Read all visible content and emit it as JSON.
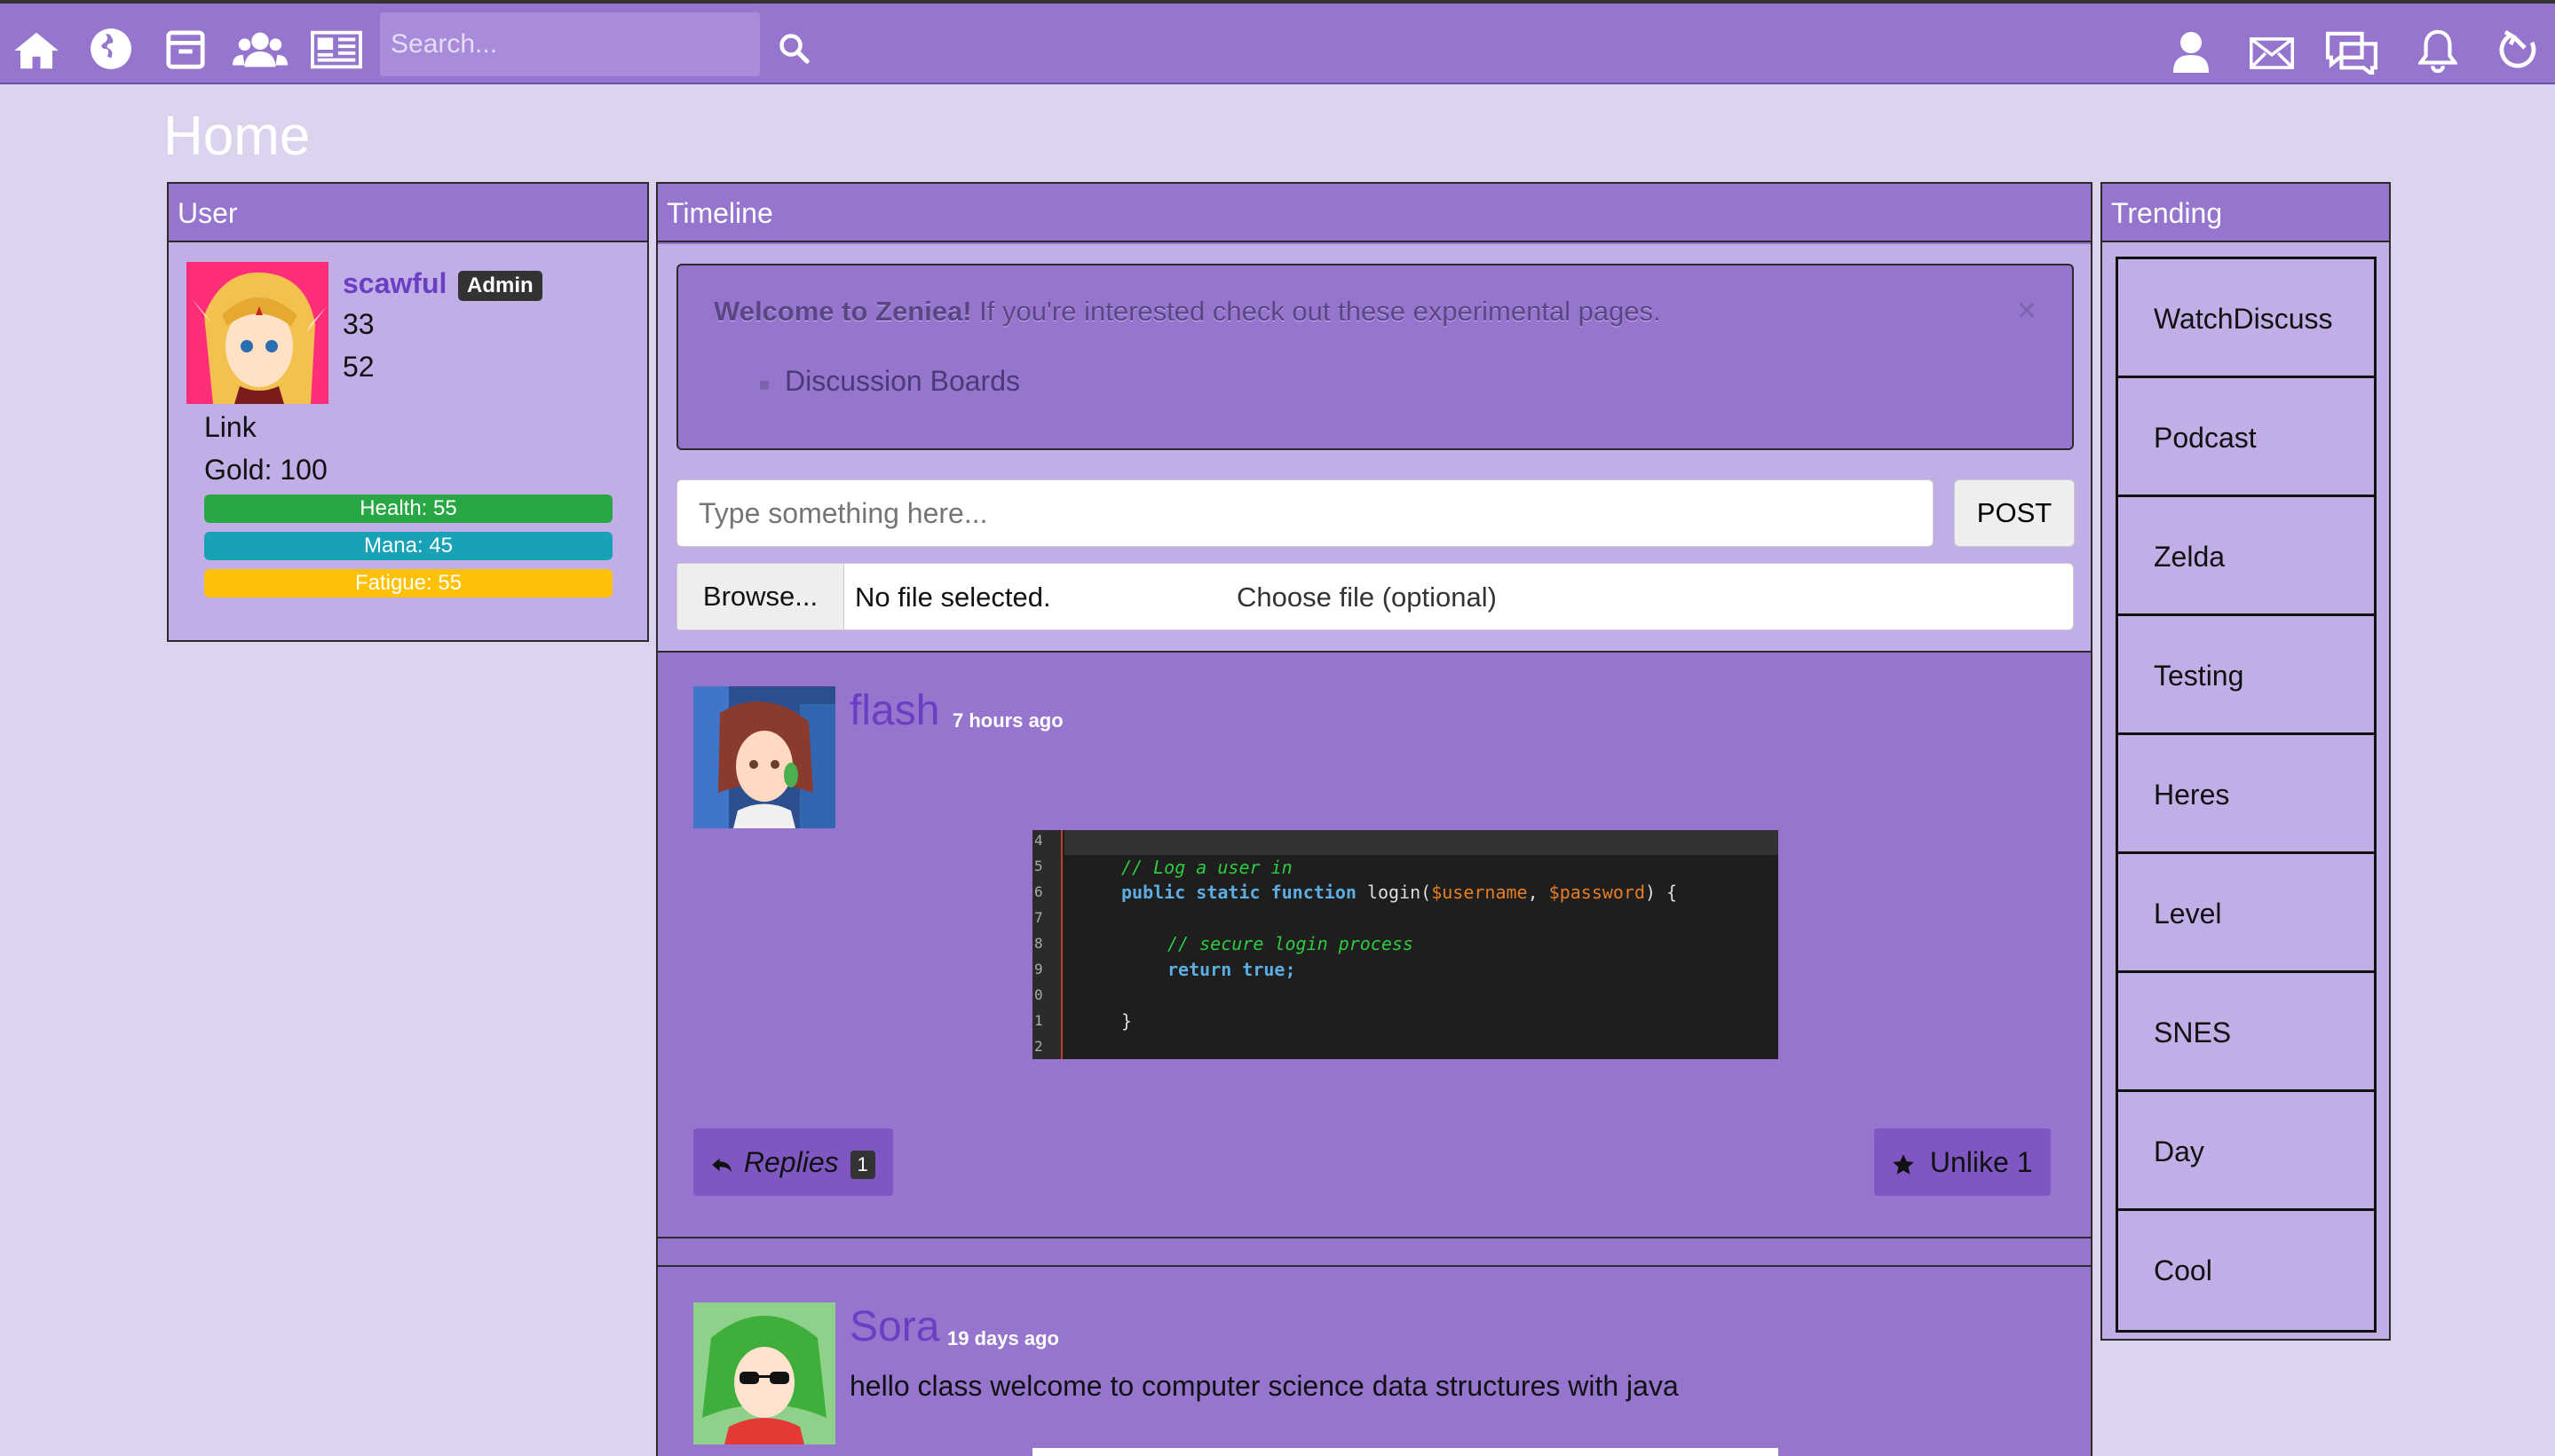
{
  "nav": {
    "icons": [
      "home-icon",
      "globe-icon",
      "inbox-icon",
      "users-icon",
      "newspaper-icon",
      "search-icon",
      "user-icon",
      "mail-icon",
      "chat-icon",
      "bell-icon",
      "logout-icon"
    ],
    "search_placeholder": "Search..."
  },
  "page": {
    "title": "Home"
  },
  "user_panel": {
    "heading": "User",
    "username": "scawful",
    "badge": "Admin",
    "stat1": "33",
    "stat2": "52",
    "character": "Link",
    "gold": "Gold: 100",
    "health_label": "Health: 55",
    "mana_label": "Mana: 45",
    "fatigue_label": "Fatigue: 55",
    "health_value": 55,
    "mana_value": 45,
    "fatigue_value": 55,
    "colors": {
      "health": "#28a745",
      "mana": "#17a2b8",
      "fatigue": "#ffc107"
    }
  },
  "timeline": {
    "heading": "Timeline",
    "alert": {
      "bold": "Welcome to Zeniea!",
      "text": " If you're interested check out these experimental pages.",
      "close": "×",
      "link": "Discussion Boards"
    },
    "post_placeholder": "Type something here...",
    "post_button": "POST",
    "browse_button": "Browse...",
    "file_status": "No file selected.",
    "file_label": "Choose file (optional)",
    "posts": [
      {
        "user": "flash",
        "time": "7 hours ago",
        "code": {
          "line_numbers": [
            "4",
            "5",
            "6",
            "7",
            "8",
            "9",
            "0",
            "1",
            "2"
          ],
          "comment1": "// Log a user in",
          "kw": "public static function",
          "fn": " login(",
          "arg1": "$username",
          "sep": ", ",
          "arg2": "$password",
          "close": ") {",
          "comment2": "// secure login process",
          "ret": "return true;",
          "brace": "}"
        },
        "replies_label": "Replies",
        "replies_count": "1",
        "like_label": "Unlike 1"
      },
      {
        "user": "Sora",
        "time": "19 days ago",
        "text": "hello class welcome to computer science data structures with java"
      }
    ]
  },
  "trending": {
    "heading": "Trending",
    "items": [
      "WatchDiscuss",
      "Podcast",
      "Zelda",
      "Testing",
      "Heres",
      "Level",
      "SNES",
      "Day",
      "Cool"
    ]
  }
}
